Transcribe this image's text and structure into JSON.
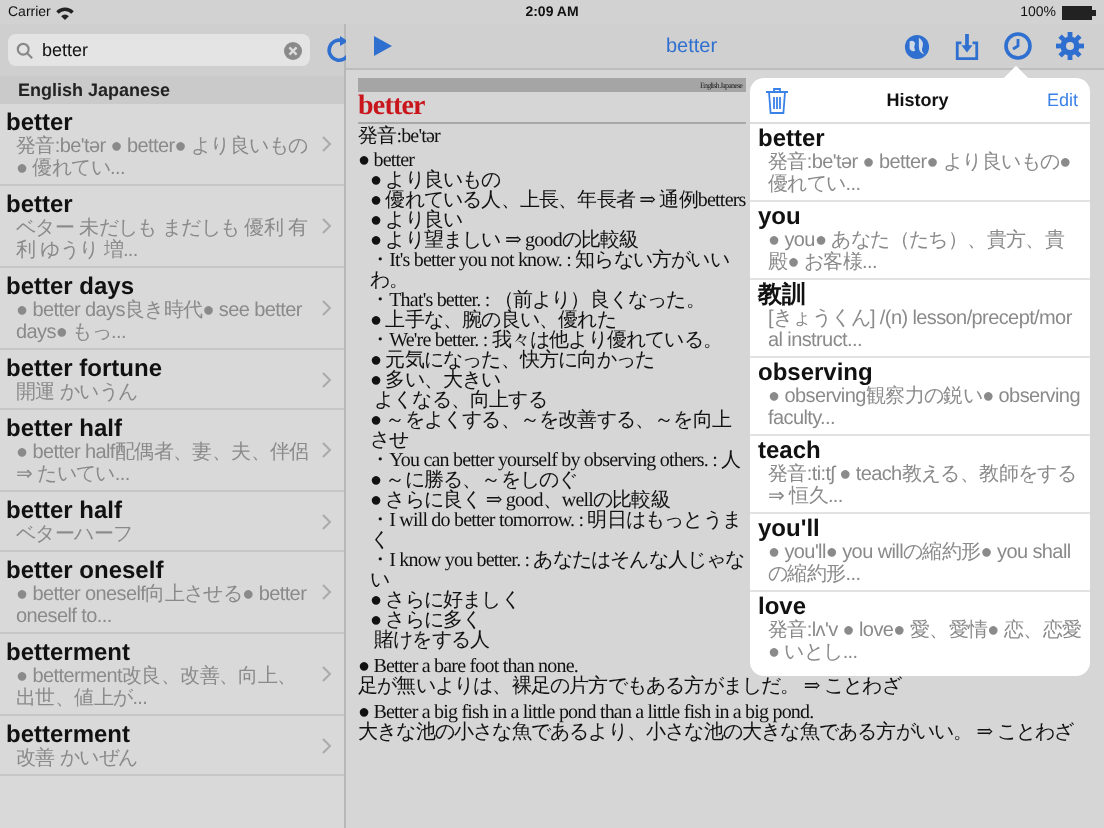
{
  "status_bar": {
    "carrier": "Carrier",
    "time": "2:09 AM",
    "battery": "100%"
  },
  "search": {
    "value": "better"
  },
  "results": {
    "section": "English Japanese",
    "rows": [
      {
        "word": "better",
        "summary": "発音:be'tər ● better● より良いもの● 優れてい..."
      },
      {
        "word": "better",
        "summary": "ベター 未だしも まだしも 優利 有利 ゆうり 増..."
      },
      {
        "word": "better days",
        "summary": "● better days良き時代● see better days● もっ..."
      },
      {
        "word": "better fortune",
        "summary": "開運 かいうん"
      },
      {
        "word": "better half",
        "summary": "● better half配偶者、妻、夫、伴侶 ⇒ たいてい..."
      },
      {
        "word": "better half",
        "summary": "ベターハーフ"
      },
      {
        "word": "better oneself",
        "summary": "● better oneself向上させる● better oneself to..."
      },
      {
        "word": "betterment",
        "summary": "● betterment改良、改善、向上、出世、値上が..."
      },
      {
        "word": "betterment",
        "summary": "改善 かいぜん"
      }
    ]
  },
  "toolbar": {
    "title": "better",
    "history_selected": true
  },
  "article": {
    "source": "English Japanese",
    "headword": "better",
    "pronunciation": "発音:be'tər",
    "lines": [
      {
        "kind": "top",
        "text": "● better"
      },
      {
        "kind": "sense",
        "text": "● より良いもの"
      },
      {
        "kind": "sense",
        "text": "● 優れている人、上長、年長者 ⇒ 通例betters"
      },
      {
        "kind": "sense",
        "text": "● より良い"
      },
      {
        "kind": "sense",
        "text": "● より望ましい ⇒ goodの比較級"
      },
      {
        "kind": "example",
        "text": "・It's better you not know. : 知らない方がいいわ。"
      },
      {
        "kind": "example",
        "text": "・That's better. : （前より）良くなった。"
      },
      {
        "kind": "sense",
        "text": "● 上手な、腕の良い、優れた"
      },
      {
        "kind": "example",
        "text": "・We're better. : 我々は他より優れている。"
      },
      {
        "kind": "sense",
        "text": "● 元気になった、快方に向かった"
      },
      {
        "kind": "sense",
        "text": "● 多い、大きい"
      },
      {
        "kind": "plain",
        "text": "よくなる、向上する"
      },
      {
        "kind": "sense",
        "text": "● ～をよくする、～を改善する、～を向上させ"
      },
      {
        "kind": "example",
        "text": "・You can better yourself by observing others. : 人"
      },
      {
        "kind": "sense",
        "text": "● ～に勝る、～をしのぐ"
      },
      {
        "kind": "sense",
        "text": "● さらに良く ⇒ good、wellの比較級"
      },
      {
        "kind": "example",
        "text": "・I will do better tomorrow. : 明日はもっとうまく"
      },
      {
        "kind": "example",
        "text": "・I know you better. : あなたはそんな人じゃない"
      },
      {
        "kind": "sense",
        "text": "● さらに好ましく"
      },
      {
        "kind": "sense",
        "text": "● さらに多く"
      },
      {
        "kind": "plain",
        "text": "賭けをする人"
      }
    ],
    "proverbs": [
      {
        "english": "● Better a bare foot than none.",
        "japanese": "足が無いよりは、裸足の片方でもある方がましだ。 ⇒ ことわざ"
      },
      {
        "english": "● Better a big fish in a little pond than a little fish in a big pond.",
        "japanese": "大きな池の小さな魚であるより、小さな池の大きな魚である方がいい。 ⇒ ことわざ"
      }
    ]
  },
  "history": {
    "title": "History",
    "edit": "Edit",
    "items": [
      {
        "word": "better",
        "summary": "発音:be'tər ● better● より良いもの● 優れてい..."
      },
      {
        "word": "you",
        "summary": "● you● あなた（たち）、貴方、貴殿● お客様..."
      },
      {
        "word": "教訓",
        "summary": "[きょうくん] /(n) lesson/precept/moral instruct..."
      },
      {
        "word": "observing",
        "summary": "● observing観察力の鋭い● observing faculty..."
      },
      {
        "word": "teach",
        "summary": "発音:ti:tʃ ● teach教える、教師をする ⇒ 恒久..."
      },
      {
        "word": "you'll",
        "summary": "● you'll● you willの縮約形● you shallの縮約形..."
      },
      {
        "word": "love",
        "summary": "発音:lʌ'v ● love● 愛、愛情● 恋、恋愛● いとし..."
      }
    ]
  }
}
